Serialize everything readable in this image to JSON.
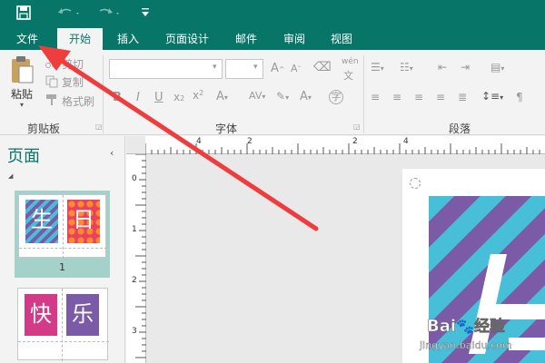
{
  "quick_access": {
    "save_icon": "save-icon",
    "undo_icon": "undo-icon",
    "redo_icon": "redo-icon",
    "customize_icon": "customize-icon"
  },
  "tabs": [
    {
      "label": "文件"
    },
    {
      "label": "开始"
    },
    {
      "label": "插入"
    },
    {
      "label": "页面设计"
    },
    {
      "label": "邮件"
    },
    {
      "label": "审阅"
    },
    {
      "label": "视图"
    }
  ],
  "clipboard": {
    "paste": "粘贴",
    "cut": "剪切",
    "copy": "复制",
    "format_painter": "格式刷",
    "group": "剪贴板"
  },
  "font": {
    "group": "字体",
    "bold": "B",
    "italic": "I",
    "underline": "U",
    "phonetic": "wén",
    "enclose": "字"
  },
  "paragraph": {
    "group": "段落"
  },
  "pages_pane": {
    "title": "页面",
    "page1_number": "1",
    "page1_chars": [
      "生",
      "日"
    ],
    "page2_chars": [
      "快",
      "乐"
    ]
  },
  "ruler": {
    "h_numbers": [
      "4",
      "2",
      "2",
      "4"
    ],
    "v_numbers": [
      "0",
      "1",
      "2",
      "3"
    ]
  },
  "watermark": {
    "brand": "Bai",
    "brand2": "经验",
    "url": "jingyan.baidu.com"
  },
  "colors": {
    "accent": "#077568",
    "arrow": "#ef3c3c"
  }
}
